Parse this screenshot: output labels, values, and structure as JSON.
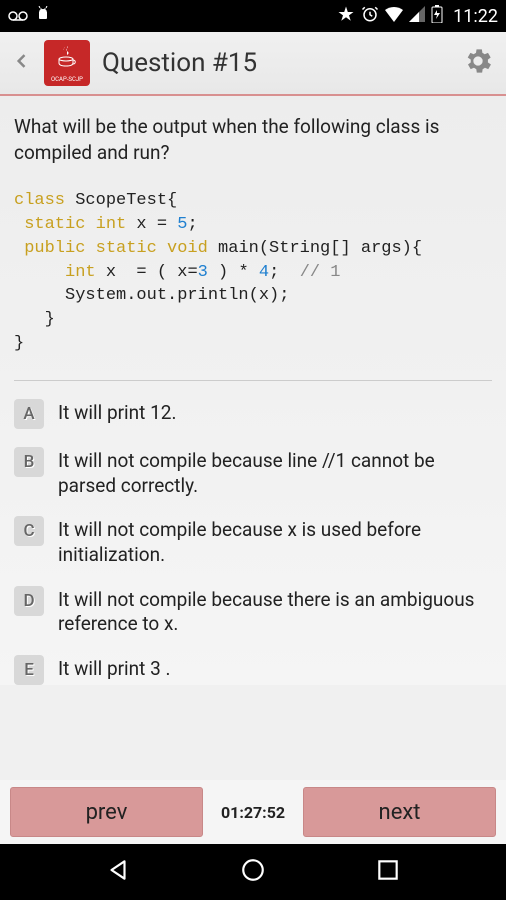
{
  "status": {
    "time": "11:22"
  },
  "header": {
    "title": "Question #15",
    "logo_text": "OCAP-SCJP"
  },
  "question": {
    "prompt": "What will be the output when the following class is compiled and run?",
    "code": {
      "line1_kw": "class",
      "line1_name": " ScopeTest{",
      "line2_kw": " static int",
      "line2_rest": " x = ",
      "line2_num": "5",
      "line2_end": ";",
      "line3_kw": " public static void",
      "line3_rest": " main(String[] args){",
      "line4_kw": "     int",
      "line4_mid1": " x  = ( x=",
      "line4_num1": "3",
      "line4_mid2": " ) * ",
      "line4_num2": "4",
      "line4_mid3": ";  ",
      "line4_comment": "// 1",
      "line5": "     System.out.println(x);",
      "line6": "   }",
      "line7": "}"
    }
  },
  "answers": [
    {
      "letter": "A",
      "text": "It will print 12."
    },
    {
      "letter": "B",
      "text": "It will not compile because line //1 cannot be parsed correctly."
    },
    {
      "letter": "C",
      "text": "It will not compile because x is used before initialization."
    },
    {
      "letter": "D",
      "text": "It will not compile because there is an ambiguous reference to x."
    },
    {
      "letter": "E",
      "text": "It will print 3 ."
    }
  ],
  "footer": {
    "prev_label": "prev",
    "next_label": "next",
    "timer": "01:27:52"
  }
}
